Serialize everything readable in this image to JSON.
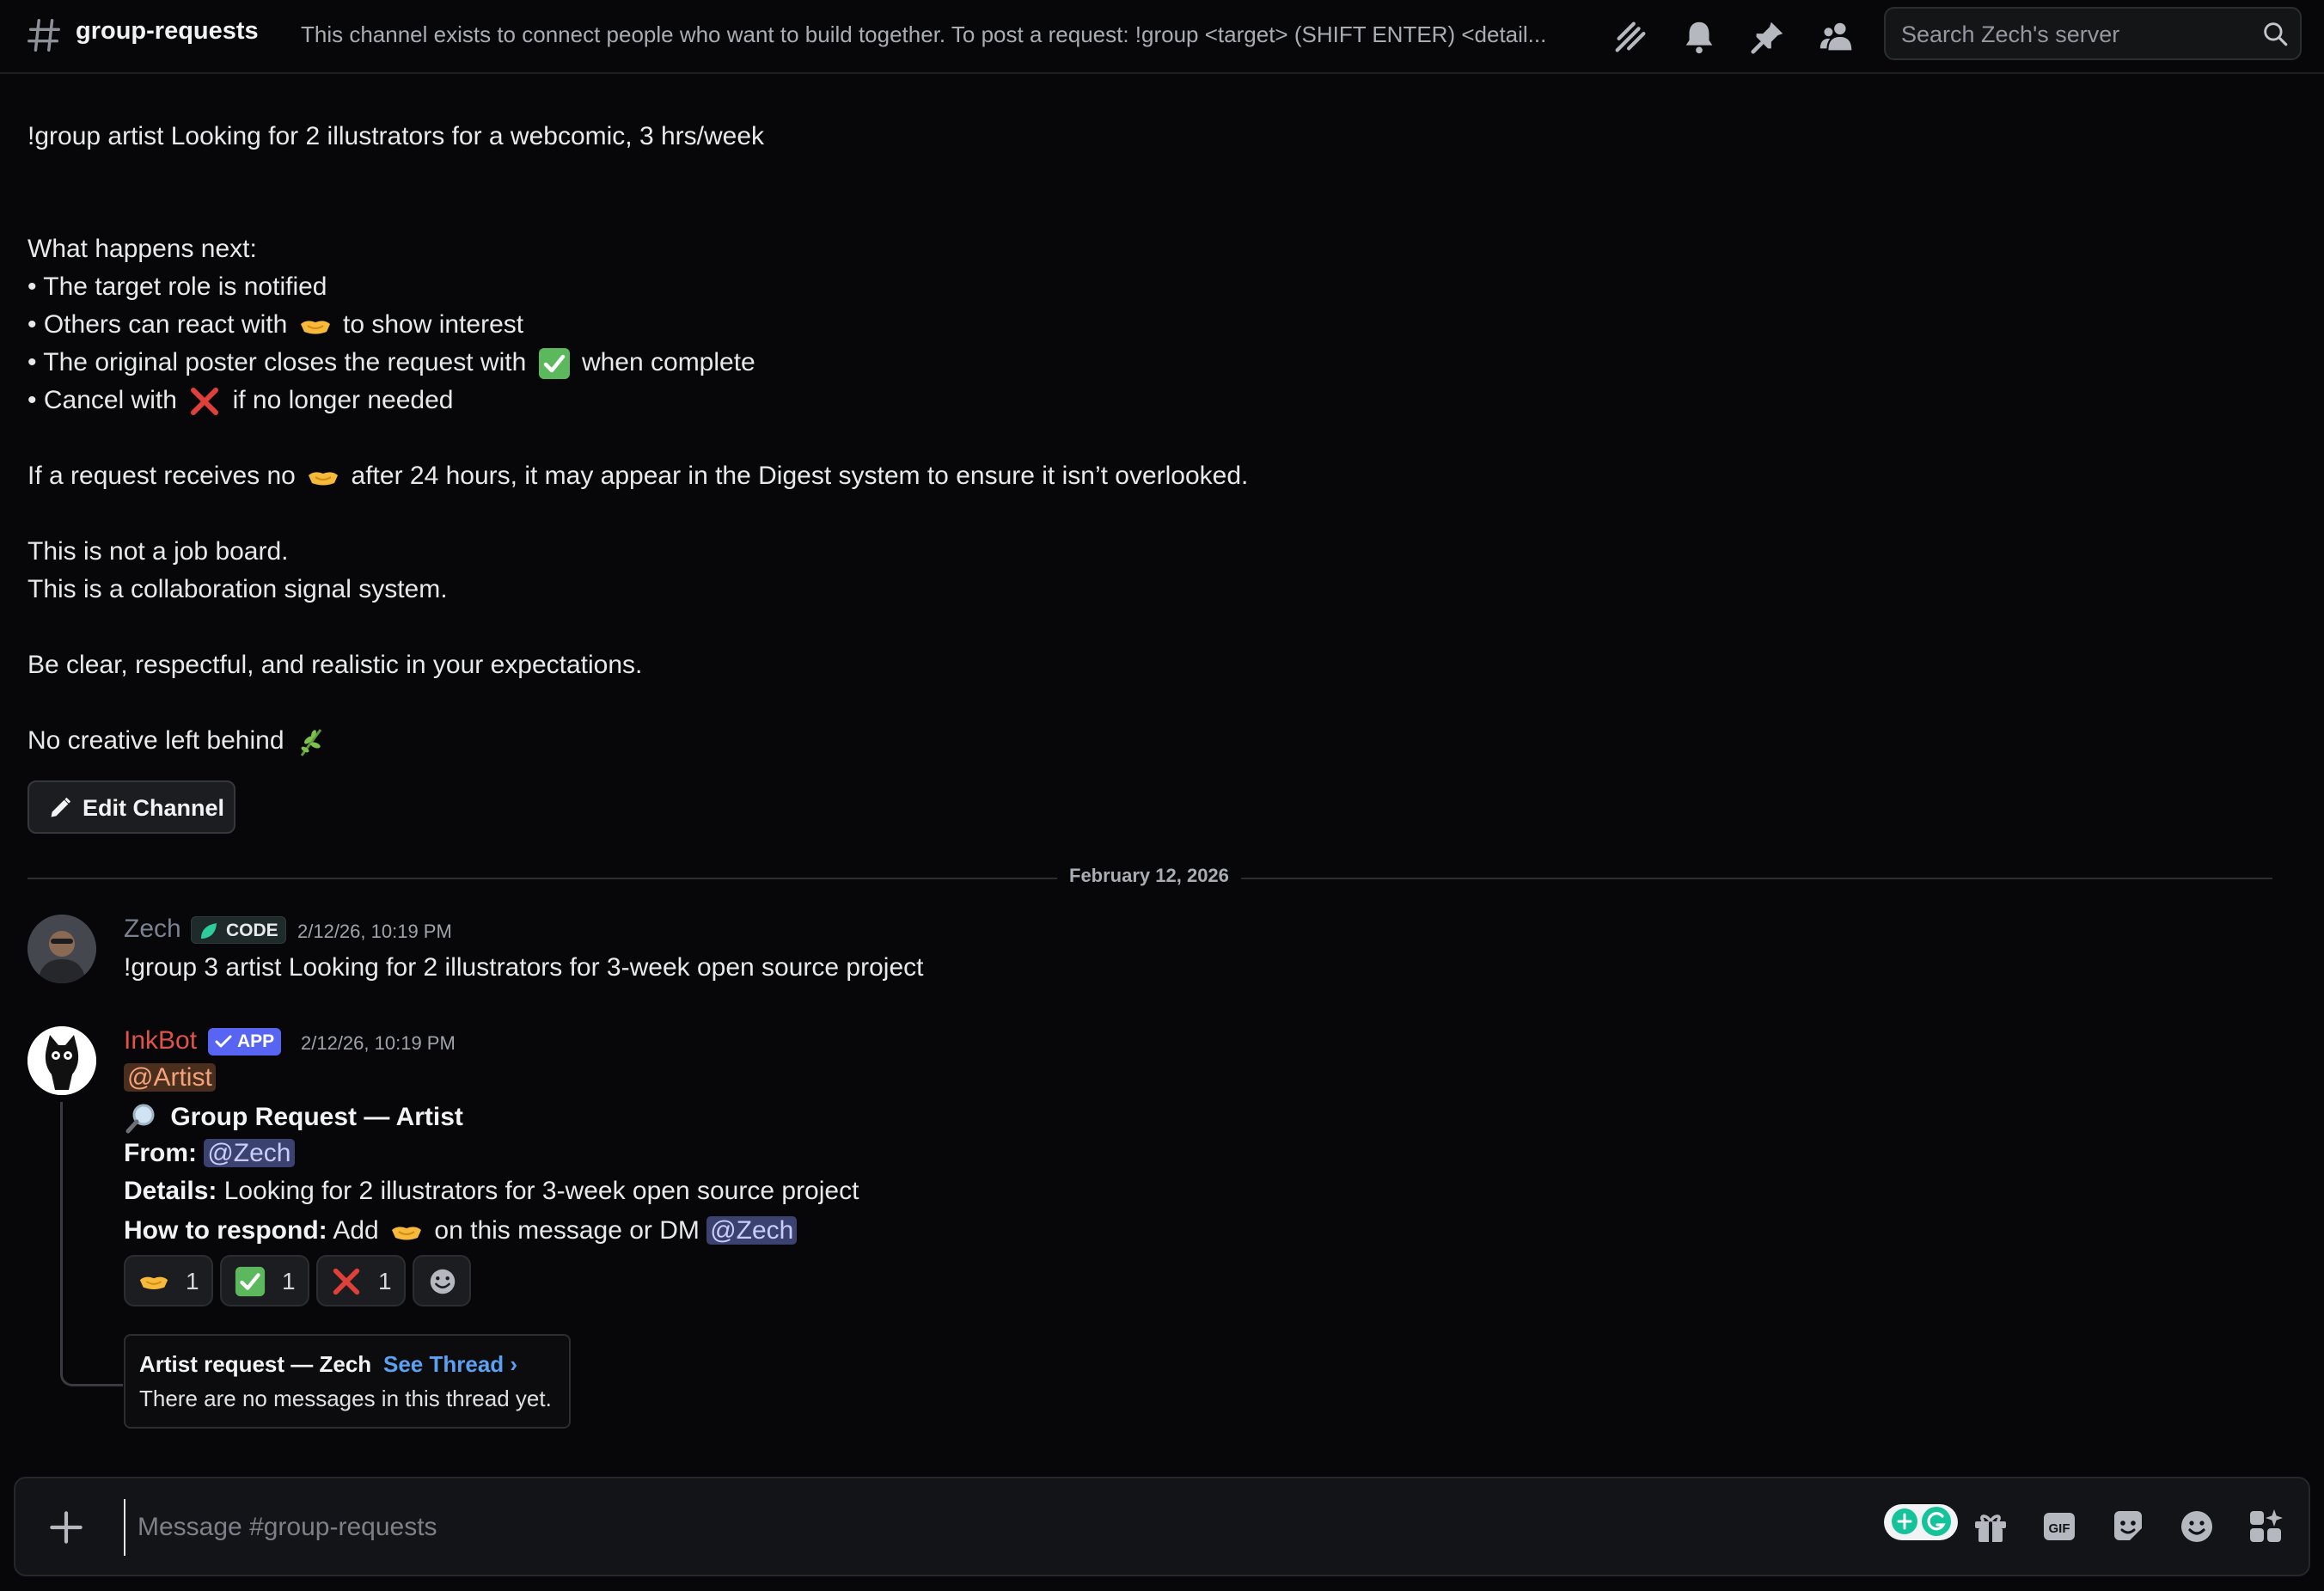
{
  "header": {
    "channel_name": "group-requests",
    "topic": "This channel exists to connect people who want to build together. To post a request: !group <target> (SHIFT ENTER) <detail...",
    "search_placeholder": "Search Zech's server"
  },
  "description": {
    "line_example": "!group artist Looking for 2 illustrators for a webcomic, 3 hrs/week",
    "what_next": "What happens next:",
    "bullet_1": "• The target role is notified",
    "bullet_2_a": "• Others can react with",
    "bullet_2_b": "to show interest",
    "bullet_3_a": "• The original poster closes the request with",
    "bullet_3_b": "when complete",
    "bullet_4_a": "• Cancel with",
    "bullet_4_b": "if no longer needed",
    "digest_a": "If a request receives no",
    "digest_b": "after 24 hours, it may appear in the Digest system to ensure it isn’t overlooked.",
    "not_job_board": "This is not a job board.",
    "signal_system": "This is a collaboration signal system.",
    "be_clear": "Be clear, respectful, and realistic in your expectations.",
    "no_creative": "No creative left behind",
    "edit_channel_label": "Edit Channel"
  },
  "divider": {
    "date": "February 12, 2026"
  },
  "messages": [
    {
      "username": "Zech",
      "badge": "CODE",
      "timestamp": "2/12/26, 10:19 PM",
      "text": "!group 3 artist Looking for 2 illustrators for 3-week open source project"
    },
    {
      "username": "InkBot",
      "badge": "APP",
      "timestamp": "2/12/26, 10:19 PM",
      "role_mention": "@Artist",
      "title": "Group Request — Artist",
      "from_label": "From:",
      "from_mention": "@Zech",
      "details_label": "Details:",
      "details_text": "Looking for 2 illustrators for 3-week open source project",
      "respond_label": "How to respond:",
      "respond_a": "Add",
      "respond_b": "on this message or DM",
      "respond_mention": "@Zech",
      "reactions": [
        {
          "emoji": "handshake",
          "count": "1"
        },
        {
          "emoji": "check-mark",
          "count": "1"
        },
        {
          "emoji": "cross-mark",
          "count": "1"
        }
      ],
      "thread": {
        "title": "Artist request — Zech",
        "link": "See Thread ›",
        "empty": "There are no messages in this thread yet."
      }
    }
  ],
  "composer": {
    "placeholder": "Message #group-requests"
  },
  "colors": {
    "background": "#070709",
    "inkbot_name": "#e0524a",
    "zech_name": "#7a8190",
    "app_badge": "#5865f2",
    "link": "#5aa1f2"
  }
}
